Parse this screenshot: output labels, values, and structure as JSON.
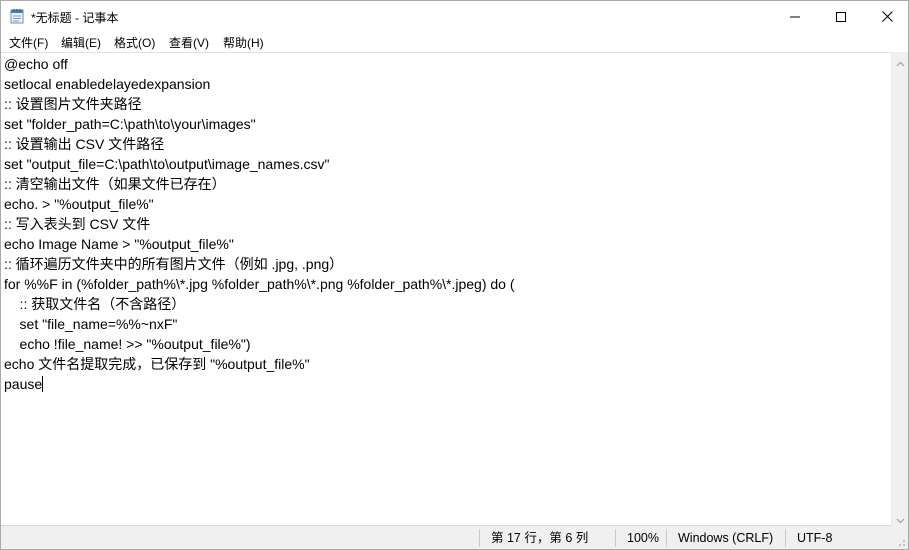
{
  "window": {
    "title": "*无标题 - 记事本",
    "app_icon": "notepad-icon",
    "controls": {
      "minimize_icon": "minimize-icon",
      "maximize_icon": "maximize-icon",
      "close_icon": "close-icon"
    }
  },
  "menu": {
    "file": "文件(F)",
    "edit": "编辑(E)",
    "format": "格式(O)",
    "view": "查看(V)",
    "help": "帮助(H)"
  },
  "editor": {
    "lines": [
      "@echo off",
      "setlocal enabledelayedexpansion",
      ":: 设置图片文件夹路径",
      "set \"folder_path=C:\\path\\to\\your\\images\"",
      ":: 设置输出 CSV 文件路径",
      "set \"output_file=C:\\path\\to\\output\\image_names.csv\"",
      ":: 清空输出文件（如果文件已存在）",
      "echo. > \"%output_file%\"",
      ":: 写入表头到 CSV 文件",
      "echo Image Name > \"%output_file%\"",
      ":: 循环遍历文件夹中的所有图片文件（例如 .jpg, .png）",
      "for %%F in (%folder_path%\\*.jpg %folder_path%\\*.png %folder_path%\\*.jpeg) do (",
      "    :: 获取文件名（不含路径）",
      "    set \"file_name=%%~nxF\"",
      "    echo !file_name! >> \"%output_file%\")",
      "echo 文件名提取完成，已保存到 \"%output_file%\"",
      "pause"
    ]
  },
  "statusbar": {
    "position": "第 17 行，第 6 列",
    "zoom": "100%",
    "line_ending": "Windows (CRLF)",
    "encoding": "UTF-8"
  }
}
